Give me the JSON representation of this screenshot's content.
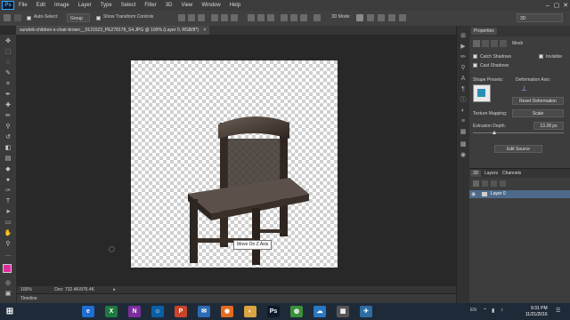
{
  "menubar": {
    "logo": "Ps",
    "items": [
      "File",
      "Edit",
      "Image",
      "Layer",
      "Type",
      "Select",
      "Filter",
      "3D",
      "View",
      "Window",
      "Help"
    ],
    "window_controls": [
      "–",
      "▢",
      "✕"
    ]
  },
  "options": {
    "auto_select_label": "Auto-Select:",
    "auto_select_value": "Group",
    "show_transform_label": "Show Transform Controls",
    "mode_3d_label": "3D Mode:",
    "workspace_value": "3D"
  },
  "document": {
    "tab_title": "sundvik-children-s-chair-brown__0121523_PE278178_S4.JPG @ 100% (Layer 0, RGB/8*)",
    "tab_close": "×"
  },
  "tooltip": "Move On Z Axis",
  "status": {
    "zoom": "100%",
    "doc_info": "Doc: 732.4K/976.4K"
  },
  "timeline_label": "Timeline",
  "properties": {
    "tab": "Properties",
    "mesh_label": "Mesh",
    "catch_shadows": "Catch Shadows",
    "invisible": "Invisible",
    "cast_shadows": "Cast Shadows",
    "shape_presets": "Shape Presets:",
    "deformation_axis": "Deformation Axis:",
    "reset_deformation": "Reset Deformation",
    "texture_mapping_label": "Texture Mapping:",
    "texture_mapping_value": "Scale",
    "extrusion_depth_label": "Extrusion Depth:",
    "extrusion_depth_value": "13.28 px",
    "edit_source": "Edit Source"
  },
  "layers": {
    "tabs": [
      "3D",
      "Layers",
      "Channels"
    ],
    "selected_layer": "Layer 0"
  },
  "taskbar": {
    "language": "EN",
    "time": "9:31 PM",
    "date": "11/21/2016",
    "apps": [
      {
        "label": "e",
        "color": "#1e6fd1"
      },
      {
        "label": "X",
        "color": "#1f7a3f"
      },
      {
        "label": "N",
        "color": "#7b2f9e"
      },
      {
        "label": "☺",
        "color": "#0a5fa8"
      },
      {
        "label": "P",
        "color": "#c8452b"
      },
      {
        "label": "✉",
        "color": "#2d6bb5"
      },
      {
        "label": "◉",
        "color": "#e26b1d"
      },
      {
        "label": "◐",
        "color": "#d9a441"
      },
      {
        "label": "Ps",
        "color": "#0e1a2b"
      },
      {
        "label": "◍",
        "color": "#3b8f3b"
      },
      {
        "label": "☁",
        "color": "#2b78c2"
      },
      {
        "label": "▦",
        "color": "#555"
      },
      {
        "label": "✈",
        "color": "#2e6da4"
      }
    ]
  }
}
